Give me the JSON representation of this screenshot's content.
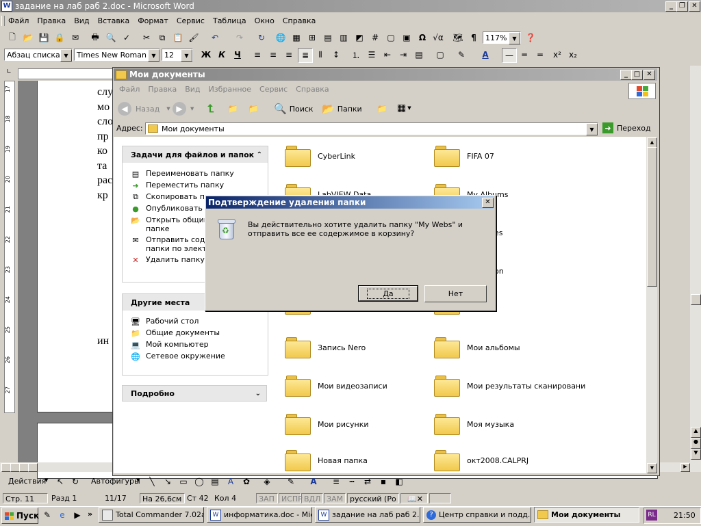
{
  "word": {
    "title": "задание на  лаб раб 2.doc - Microsoft Word",
    "menu": [
      "Файл",
      "Правка",
      "Вид",
      "Вставка",
      "Формат",
      "Сервис",
      "Таблица",
      "Окно",
      "Справка"
    ],
    "zoom": "117%",
    "style": "Абзац списка",
    "font": "Times New Roman",
    "size": "12",
    "doc_fragments": [
      "слу",
      "мо",
      "сло",
      "пр",
      "ко",
      "та",
      "рас",
      "кр",
      "ин"
    ],
    "ruler_numbers": [
      "17",
      "18",
      "19",
      "20",
      "21",
      "22",
      "23",
      "24",
      "25",
      "26",
      "27"
    ],
    "draw_actions": "Действия",
    "draw_autoshapes": "Автофигуры",
    "status": {
      "page": "Стр. 11",
      "section": "Разд 1",
      "pages": "11/17",
      "at": "На 26,6см",
      "line": "Ст 42",
      "col": "Кол 4",
      "rec": "ЗАП",
      "trk": "ИСПР",
      "ext": "ВДЛ",
      "ovr": "ЗАМ",
      "lang": "русский (Ро"
    }
  },
  "explorer": {
    "title": "Мои документы",
    "menu": [
      "Файл",
      "Правка",
      "Вид",
      "Избранное",
      "Сервис",
      "Справка"
    ],
    "back": "Назад",
    "search": "Поиск",
    "folders": "Папки",
    "address_label": "Адрес:",
    "address": "Мои документы",
    "go": "Переход",
    "tasks_title": "Задачи для файлов и папок",
    "tasks": [
      "Переименовать папку",
      "Переместить папку",
      "Скопировать папку",
      "Опубликовать папку в вебе",
      "Открыть общий доступ к этой папке",
      "Отправить содержимое этой папки по электронной почте",
      "Удалить папку"
    ],
    "tasks_visible": [
      "Переименовать папку",
      "Переместить папку",
      "Скопировать пап",
      "Опубликовать пап",
      "Открыть общий",
      "папке",
      "Отправить содер",
      "папки по электро",
      "Удалить папку"
    ],
    "other_title": "Другие места",
    "other": [
      "Рабочий стол",
      "Общие документы",
      "Мой компьютер",
      "Сетевое окружение"
    ],
    "details_title": "Подробно",
    "items_left": [
      "CyberLink",
      "LabVIEW Data",
      "",
      "",
      "",
      "Запись Nero",
      "Мои видеозаписи",
      "Мои рисунки",
      "Новая папка"
    ],
    "items_right": [
      "FIFA 07",
      "My Albums",
      "",
      "",
      "",
      "Мои альбомы",
      "Мои результаты сканировани",
      "Моя музыка",
      "окт2008.CALPRJ"
    ],
    "partial_right": [
      "es",
      "on"
    ]
  },
  "dialog": {
    "title": "Подтверждение удаления папки",
    "message": "Вы действительно хотите удалить папку \"My Webs\" и отправить все ее содержимое в корзину?",
    "yes": "Да",
    "no": "Нет"
  },
  "taskbar": {
    "start": "Пуск",
    "buttons": [
      "Total Commander 7.02a...",
      "информатика.doc - Mic...",
      "задание на  лаб раб 2...",
      "Центр справки и подд...",
      "Мои документы"
    ],
    "lang": "RL",
    "time": "21:50"
  }
}
